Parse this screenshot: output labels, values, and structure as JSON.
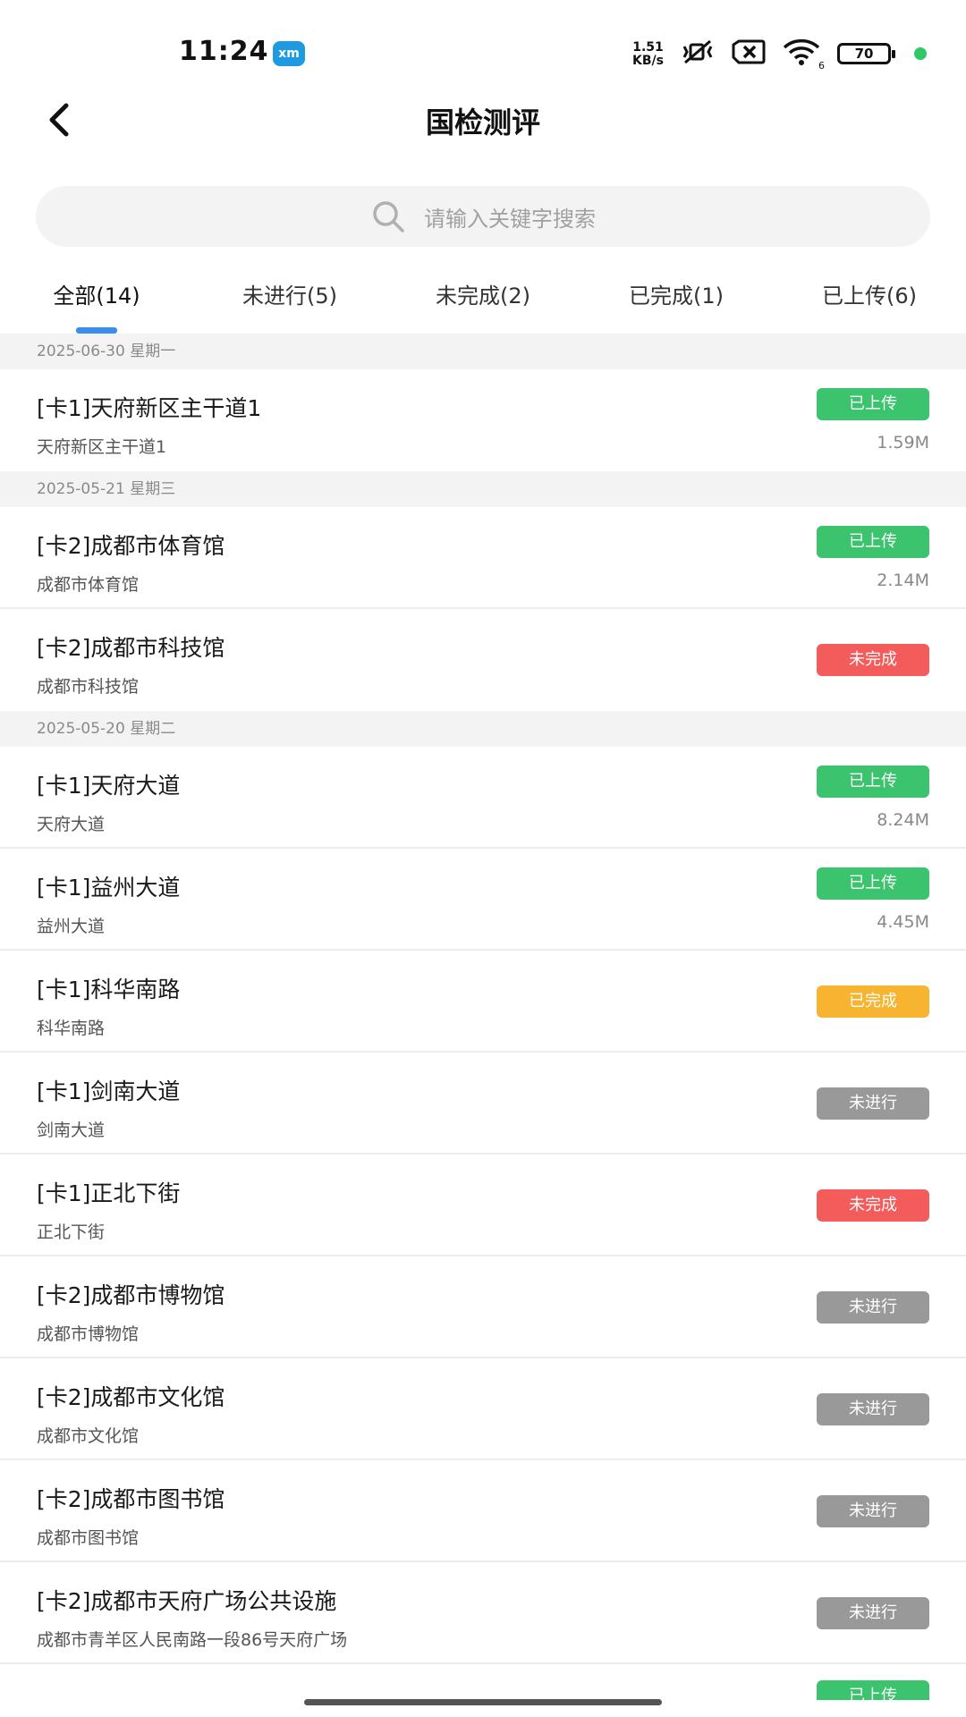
{
  "status_bar": {
    "time": "11:24",
    "app_icon_text": "xm",
    "net_speed_value": "1.51",
    "net_speed_unit": "KB/s",
    "wifi_label": "6",
    "battery": "70",
    "icons": [
      "mute-vibrate-icon",
      "sim-error-icon",
      "wifi-icon",
      "battery-icon"
    ]
  },
  "header": {
    "title": "国检测评",
    "back_icon": "back-arrow-icon"
  },
  "search": {
    "placeholder": "请输入关键字搜索"
  },
  "tabs": [
    {
      "label": "全部(14)",
      "active": true
    },
    {
      "label": "未进行(5)",
      "active": false
    },
    {
      "label": "未完成(2)",
      "active": false
    },
    {
      "label": "已完成(1)",
      "active": false
    },
    {
      "label": "已上传(6)",
      "active": false
    }
  ],
  "status_colors": {
    "已上传": "#3cc36e",
    "未完成": "#f45b5b",
    "已完成": "#f7b430",
    "未进行": "#999999"
  },
  "groups": [
    {
      "date": "2025-06-30 星期一",
      "items": [
        {
          "title": "[卡1]天府新区主干道1",
          "subtitle": "天府新区主干道1",
          "status": "已上传",
          "size": "1.59M"
        }
      ]
    },
    {
      "date": "2025-05-21 星期三",
      "items": [
        {
          "title": "[卡2]成都市体育馆",
          "subtitle": "成都市体育馆",
          "status": "已上传",
          "size": "2.14M"
        },
        {
          "title": "[卡2]成都市科技馆",
          "subtitle": "成都市科技馆",
          "status": "未完成",
          "size": ""
        }
      ]
    },
    {
      "date": "2025-05-20 星期二",
      "items": [
        {
          "title": "[卡1]天府大道",
          "subtitle": "天府大道",
          "status": "已上传",
          "size": "8.24M"
        },
        {
          "title": "[卡1]益州大道",
          "subtitle": "益州大道",
          "status": "已上传",
          "size": "4.45M"
        },
        {
          "title": "[卡1]科华南路",
          "subtitle": "科华南路",
          "status": "已完成",
          "size": ""
        },
        {
          "title": "[卡1]剑南大道",
          "subtitle": "剑南大道",
          "status": "未进行",
          "size": ""
        },
        {
          "title": "[卡1]正北下街",
          "subtitle": "正北下街",
          "status": "未完成",
          "size": ""
        },
        {
          "title": "[卡2]成都市博物馆",
          "subtitle": "成都市博物馆",
          "status": "未进行",
          "size": ""
        },
        {
          "title": "[卡2]成都市文化馆",
          "subtitle": "成都市文化馆",
          "status": "未进行",
          "size": ""
        },
        {
          "title": "[卡2]成都市图书馆",
          "subtitle": "成都市图书馆",
          "status": "未进行",
          "size": ""
        },
        {
          "title": "[卡2]成都市天府广场公共设施",
          "subtitle": "成都市青羊区人民南路一段86号天府广场",
          "status": "未进行",
          "size": ""
        }
      ]
    }
  ],
  "partial_item": {
    "status": "已上传"
  }
}
